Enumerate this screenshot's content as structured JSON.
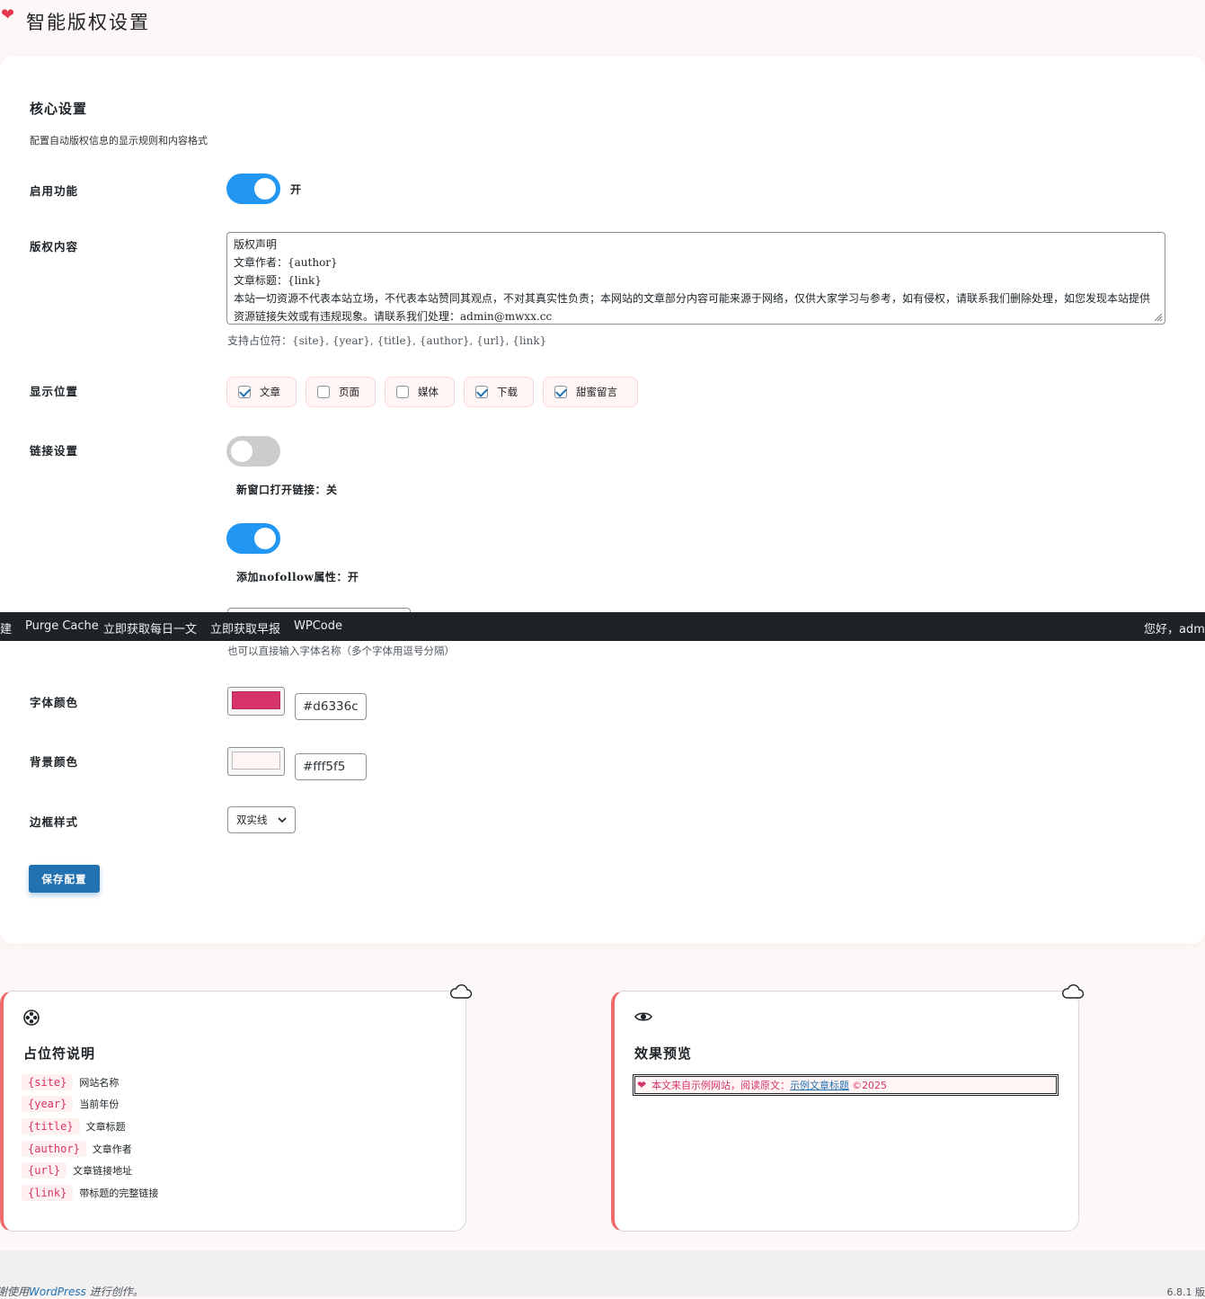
{
  "page": {
    "title": "智能版权设置"
  },
  "core": {
    "title": "核心设置",
    "desc": "配置自动版权信息的显示规则和内容格式",
    "enable_label": "启用功能",
    "enable_state": "开",
    "content_label": "版权内容",
    "content_lines": [
      "版权声明",
      "文章作者：{author}",
      "文章标题：{link}",
      "本站一切资源不代表本站立场，不代表本站赞同其观点，不对其真实性负责；本网站的文章部分内容可能来源于网络，仅供大家学习与参考，如有侵权，请联系我们删除处理，如您发现本站提供资源链接失效或有违规现象。请联系我们处理：admin@mwxx.cc"
    ],
    "placeholder_hint": "支持占位符：{site}, {year}, {title}, {author}, {url}, {link}",
    "position_label": "显示位置",
    "positions": [
      {
        "label": "文章",
        "checked": true
      },
      {
        "label": "页面",
        "checked": false
      },
      {
        "label": "媒体",
        "checked": false
      },
      {
        "label": "下载",
        "checked": true
      },
      {
        "label": "甜蜜留言",
        "checked": true
      }
    ],
    "link_label": "链接设置",
    "new_window_caption": "新窗口打开链接：关",
    "nofollow_caption": "添加nofollow属性：开",
    "font_hint": "也可以直接输入字体名称（多个字体用逗号分隔）",
    "font_color_label": "字体颜色",
    "font_color": "#d6336c",
    "bg_color_label": "背景颜色",
    "bg_color": "#fff5f5",
    "border_label": "边框样式",
    "border_value": "双实线",
    "save_label": "保存配置"
  },
  "admin_bar": {
    "items": [
      "建",
      "Purge Cache",
      "立即获取每日一文",
      "立即获取早报",
      "WPCode"
    ],
    "greeting": "您好，admi"
  },
  "placeholders_card": {
    "title": "占位符说明",
    "items": [
      {
        "code": "{site}",
        "desc": "网站名称"
      },
      {
        "code": "{year}",
        "desc": "当前年份"
      },
      {
        "code": "{title}",
        "desc": "文章标题"
      },
      {
        "code": "{author}",
        "desc": "文章作者"
      },
      {
        "code": "{url}",
        "desc": "文章链接地址"
      },
      {
        "code": "{link}",
        "desc": "带标题的完整链接"
      }
    ]
  },
  "preview_card": {
    "title": "效果预览",
    "text_prefix": "本文来自示例网站，阅读原文：",
    "link_text": "示例文章标题",
    "text_suffix": "©2025"
  },
  "footer": {
    "text_before": "谢使用",
    "link": "WordPress",
    "text_after": "进行创作。",
    "version": "6.8.1 版"
  },
  "colors": {
    "accent": "#2196f3",
    "primary": "#2271b1",
    "pink": "#d6336c"
  }
}
